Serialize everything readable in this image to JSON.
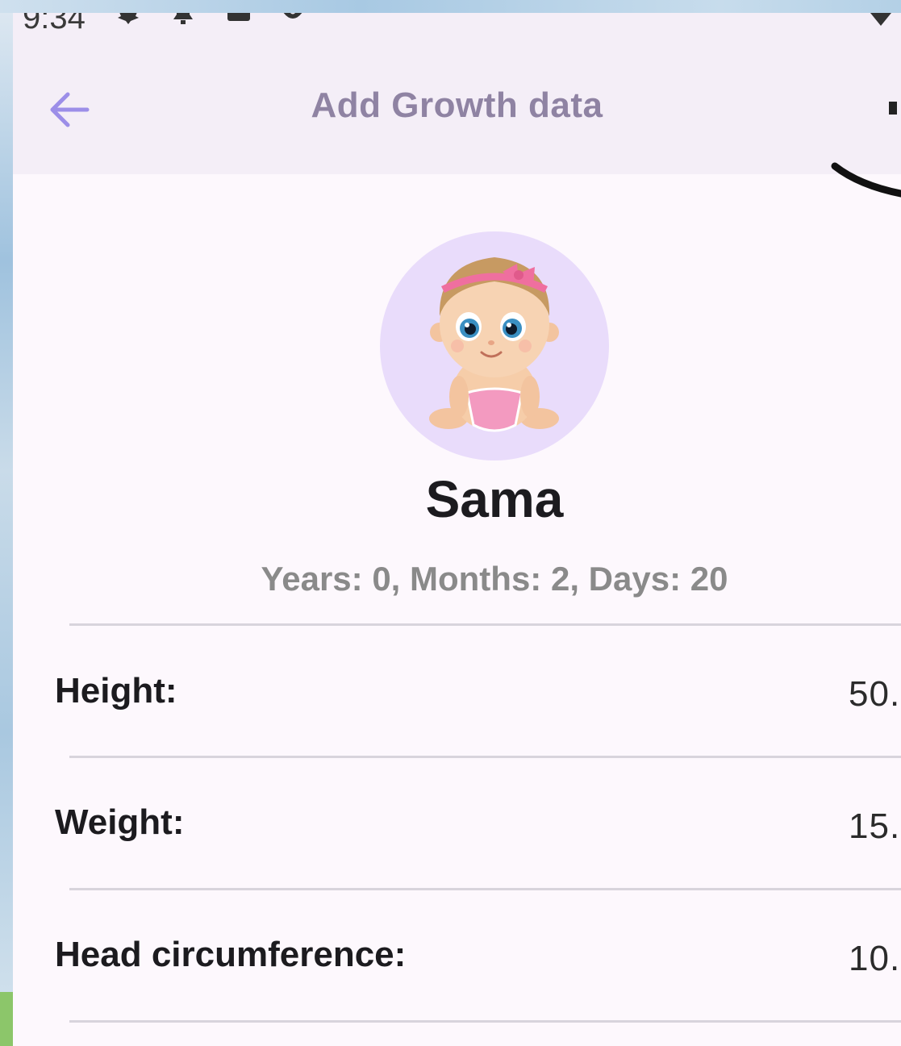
{
  "status_bar": {
    "time": "9:34",
    "icons": [
      "settings-icon",
      "bell-icon",
      "square-icon",
      "at-sign-icon",
      "signal-icon"
    ]
  },
  "app_bar": {
    "title": "Add Growth data",
    "back_icon": "arrow-left-icon"
  },
  "profile": {
    "name": "Sama",
    "age": "Years: 0, Months: 2, Days: 20",
    "avatar": "baby-avatar"
  },
  "measurements": [
    {
      "label": "Height:",
      "value": "50."
    },
    {
      "label": "Weight:",
      "value": "15."
    },
    {
      "label": "Head circumference:",
      "value": "10."
    }
  ],
  "colors": {
    "accent": "#9c8ee8",
    "title": "#8f83a3",
    "avatar_bg": "#e9dcfb",
    "app_bar_bg": "#f4eef7",
    "screen_bg": "#fdf8fd"
  }
}
